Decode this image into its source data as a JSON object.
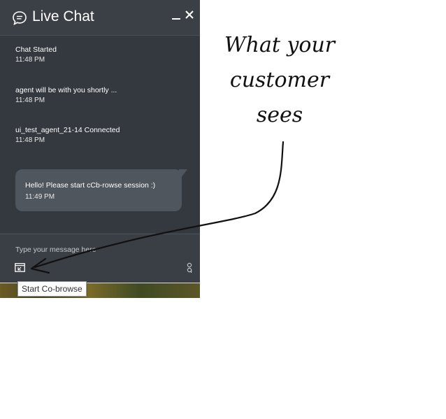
{
  "chat": {
    "title": "Live Chat",
    "messages": [
      {
        "text": "Chat Started",
        "time": "11:48 PM"
      },
      {
        "text": "agent will be with you shortly ...",
        "time": "11:48 PM"
      },
      {
        "text": "ui_test_agent_21-14 Connected",
        "time": "11:48 PM"
      }
    ],
    "customer_bubble": {
      "text": "Hello! Please start cCb-rowse session :)",
      "time": "11:49 PM"
    },
    "composer": {
      "placeholder": "Type your message here"
    },
    "tooltip": "Start Co-browse",
    "icons": {
      "header": "chat-bubble-icon",
      "minimize": "minimize-icon",
      "close": "close-icon",
      "cobrowse": "cobrowse-icon",
      "powered": "logo-icon"
    }
  },
  "annotation": {
    "lines": [
      "What your",
      "customer",
      "sees"
    ]
  },
  "colors": {
    "widget_bg": "#3a3f45",
    "bubble_bg": "#4f565e",
    "text": "#ffffff"
  }
}
